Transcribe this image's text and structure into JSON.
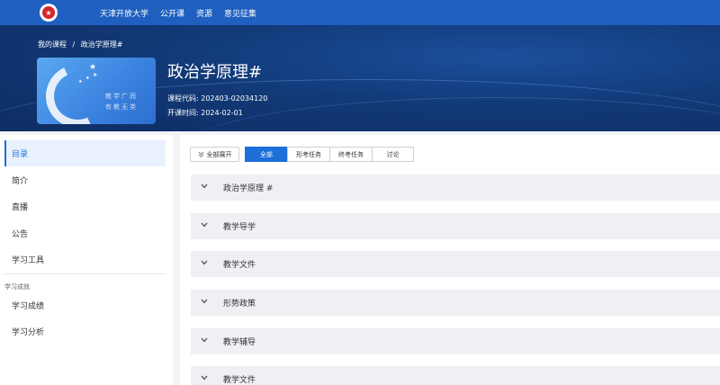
{
  "nav": {
    "logo_icon": "university-logo",
    "items": [
      "天津开放大学",
      "公开课",
      "资源",
      "意见征集"
    ]
  },
  "banner": {
    "breadcrumb": [
      "我的课程",
      "/",
      "政治学原理#"
    ],
    "cover_text_line1": "教学广而",
    "cover_text_line2": "有教无类",
    "title": "政治学原理#",
    "code_line": "课程代码: 202403-02034120",
    "date_line": "开课时间: 2024-02-01"
  },
  "sidebar": {
    "items": [
      "目录",
      "简介",
      "直播",
      "公告",
      "学习工具"
    ],
    "group_label": "学习成就",
    "group_items": [
      "学习成绩",
      "学习分析"
    ],
    "active_index": 0
  },
  "toolbar": {
    "expand_icon": "double-chevron-down-icon",
    "expand_label": "全部展开",
    "tabs": [
      "全部",
      "形考任务",
      "终考任务",
      "讨论"
    ],
    "active_tab": 0
  },
  "sections": [
    "政治学原理 #",
    "教学导学",
    "教学文件",
    "形势政策",
    "教学辅导",
    "教学文件"
  ],
  "colors": {
    "nav_bg": "#1e5fbf",
    "accent": "#1e6fd9",
    "banner_dark": "#0e2d63"
  }
}
